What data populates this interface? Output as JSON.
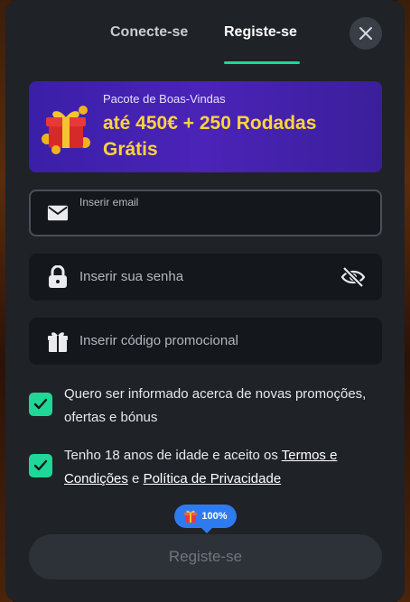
{
  "tabs": {
    "login_label": "Conecte-se",
    "register_label": "Registe-se",
    "active": "register"
  },
  "close_icon": "close-icon",
  "banner": {
    "subtitle": "Pacote de Boas-Vindas",
    "title": "até 450€ + 250 Rodadas Grátis",
    "icon": "gift-icon"
  },
  "form": {
    "email": {
      "label": "Inserir email",
      "value": "",
      "icon": "mail-icon"
    },
    "password": {
      "placeholder": "Inserir sua senha",
      "icon": "lock-icon",
      "toggle_icon": "eye-off-icon"
    },
    "promo": {
      "placeholder": "Inserir código promocional",
      "icon": "gift-icon"
    }
  },
  "consents": {
    "marketing": {
      "checked": true,
      "text": "Quero ser informado acerca de novas promoções, ofertas e bónus"
    },
    "terms": {
      "checked": true,
      "prefix": "Tenho 18 anos de idade e aceito os ",
      "terms_link": "Termos e Condições",
      "connector": " e ",
      "privacy_link": "Política de Privacidade"
    }
  },
  "progress_badge": {
    "value": "100%",
    "icon": "gift-icon"
  },
  "submit": {
    "label": "Registe-se"
  },
  "colors": {
    "accent": "#1fd796",
    "banner_title": "#ffd43b",
    "badge": "#2e7bf0",
    "background": "#1f2227"
  }
}
